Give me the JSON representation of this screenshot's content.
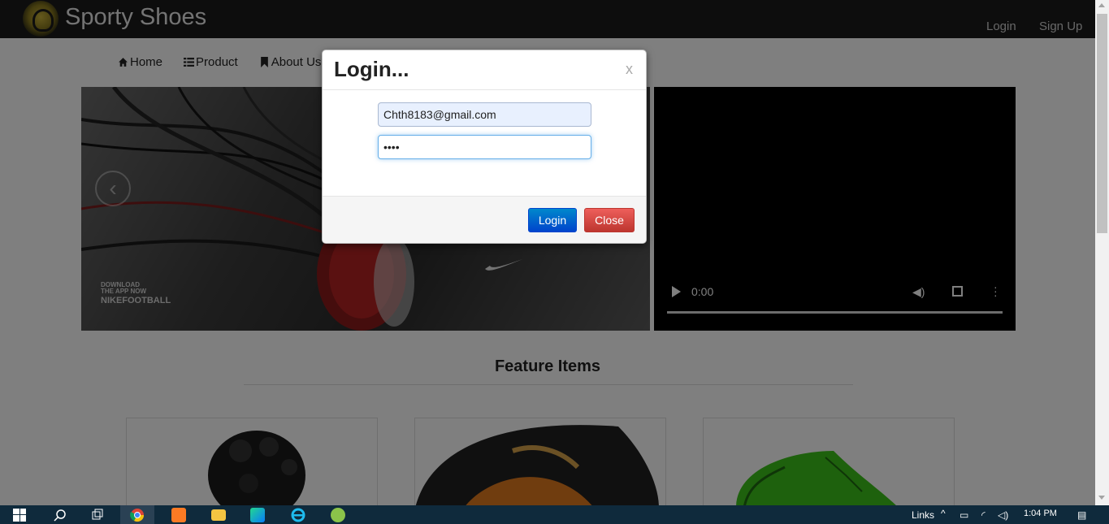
{
  "site": {
    "brand": "Sporty Shoes",
    "top_links": {
      "login": "Login",
      "signup": "Sign Up"
    },
    "nav": [
      {
        "label": "Home",
        "icon": "home-icon"
      },
      {
        "label": "Product",
        "icon": "list-icon"
      },
      {
        "label": "About Us",
        "icon": "bookmark-icon"
      }
    ],
    "banner": {
      "prev_label": "‹",
      "tag_line1": "DOWNLOAD",
      "tag_line2": "THE APP NOW",
      "tag_line3": "NIKEFOOTBALL"
    },
    "video": {
      "time": "0:00"
    },
    "feature_title": "Feature Items"
  },
  "modal": {
    "title": "Login...",
    "close_x": "x",
    "email_value": "Chth8183@gmail.com",
    "password_value": "••••",
    "login_button": "Login",
    "close_button": "Close"
  },
  "taskbar": {
    "links_label": "Links",
    "time": "1:04 PM",
    "apps": [
      "windows-start-icon",
      "search-icon",
      "task-view-icon",
      "chrome-icon",
      "xampp-icon",
      "file-explorer-icon",
      "webstorm-icon",
      "internet-explorer-icon",
      "app-icon"
    ]
  }
}
